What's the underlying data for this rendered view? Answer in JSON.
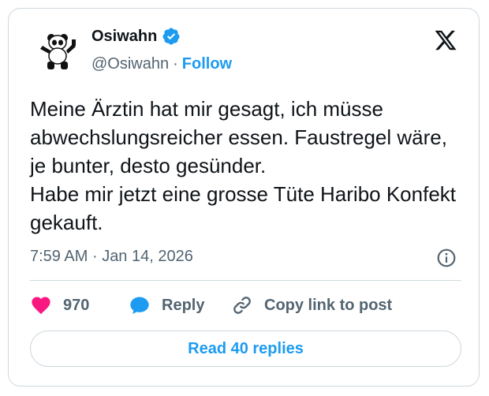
{
  "author": {
    "name": "Osiwahn",
    "handle": "@Osiwahn",
    "separator": "·",
    "follow_label": "Follow",
    "verified": true,
    "verified_color": "#1d9bf0"
  },
  "tweet": {
    "text": "Meine Ärztin hat mir gesagt, ich müsse abwechslungsreicher essen. Faustregel wäre, je bunter, desto gesünder.\nHabe mir jetzt eine grosse Tüte Haribo Konfekt gekauft.",
    "time": "7:59 AM",
    "separator": "·",
    "date": "Jan 14, 2026"
  },
  "actions": {
    "likes": "970",
    "like_icon": "heart-icon",
    "like_color": "#f91880",
    "reply_label": "Reply",
    "reply_icon": "speech-bubble-icon",
    "copy_label": "Copy link to post",
    "copy_icon": "link-icon"
  },
  "read_replies_label": "Read 40 replies",
  "accent_color": "#1d9bf0"
}
